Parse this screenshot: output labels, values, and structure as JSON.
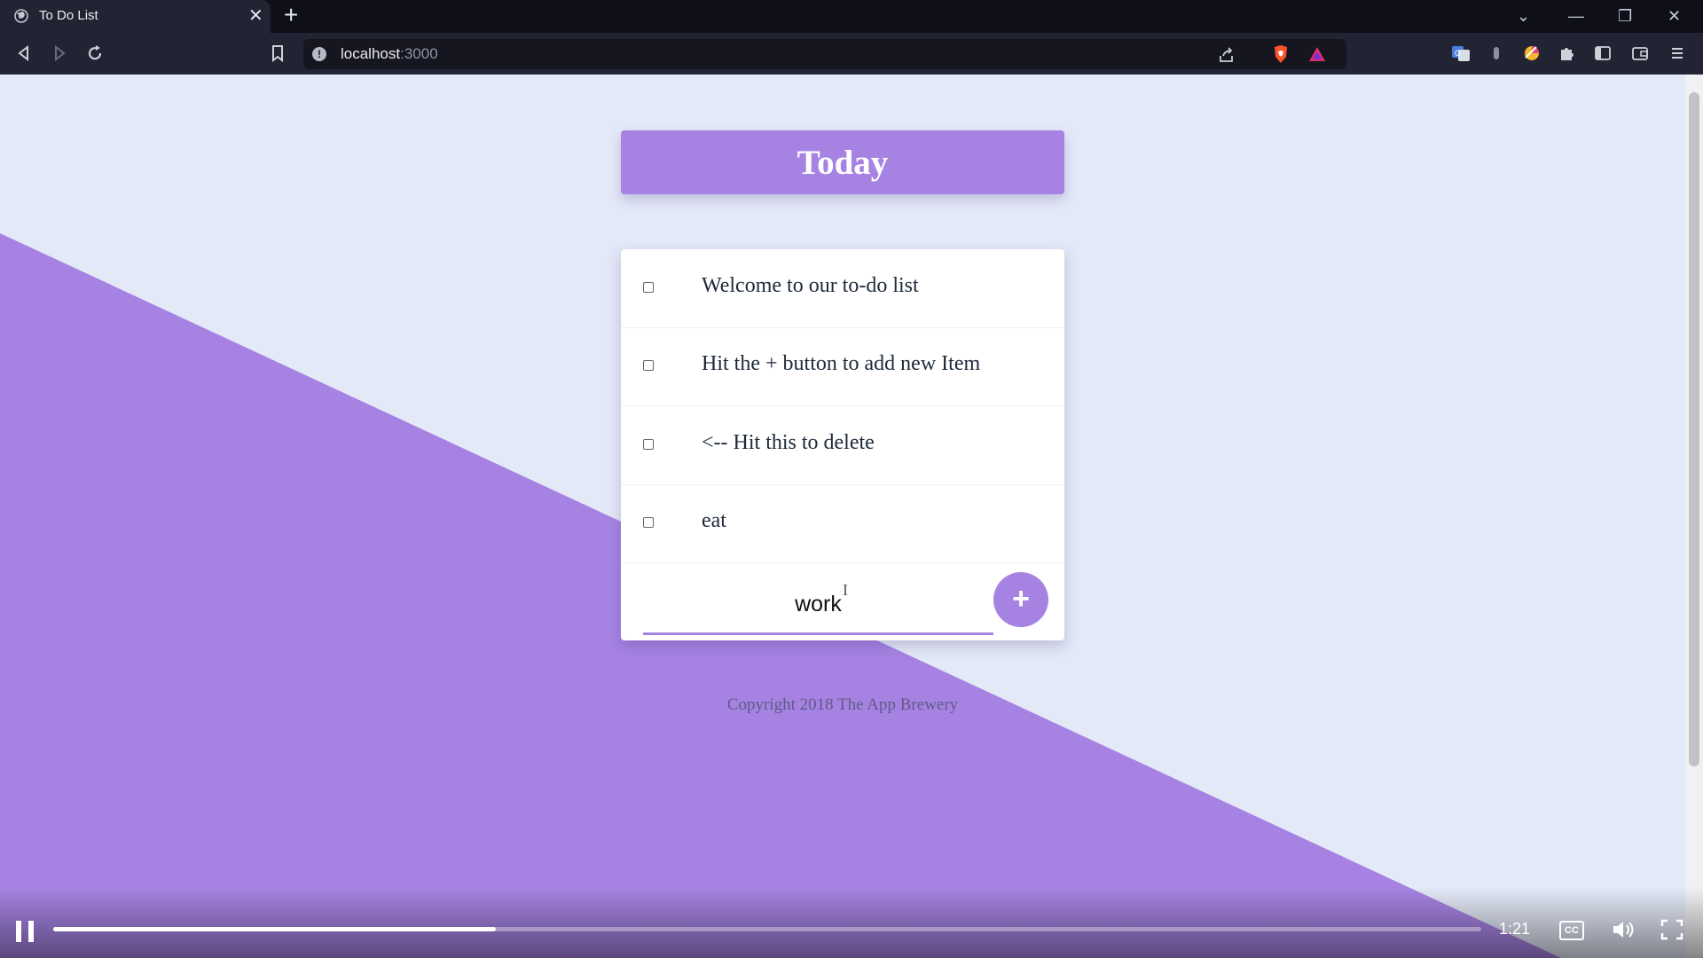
{
  "browser": {
    "tab_title": "To Do List",
    "url_host": "localhost",
    "url_port": ":3000"
  },
  "page": {
    "header": "Today",
    "items": [
      {
        "text": "Welcome to our to-do list",
        "checked": false
      },
      {
        "text": "Hit the + button to add new Item",
        "checked": false
      },
      {
        "text": "<-- Hit this to delete",
        "checked": false
      },
      {
        "text": "eat",
        "checked": false
      }
    ],
    "new_item_value": "work",
    "add_button_label": "+",
    "footer": "Copyright 2018 The App Brewery"
  },
  "video": {
    "time": "1:21",
    "progress": 0.31,
    "cc_label": "CC"
  },
  "colors": {
    "accent": "#a683e3",
    "background": "#e4e9f8"
  }
}
